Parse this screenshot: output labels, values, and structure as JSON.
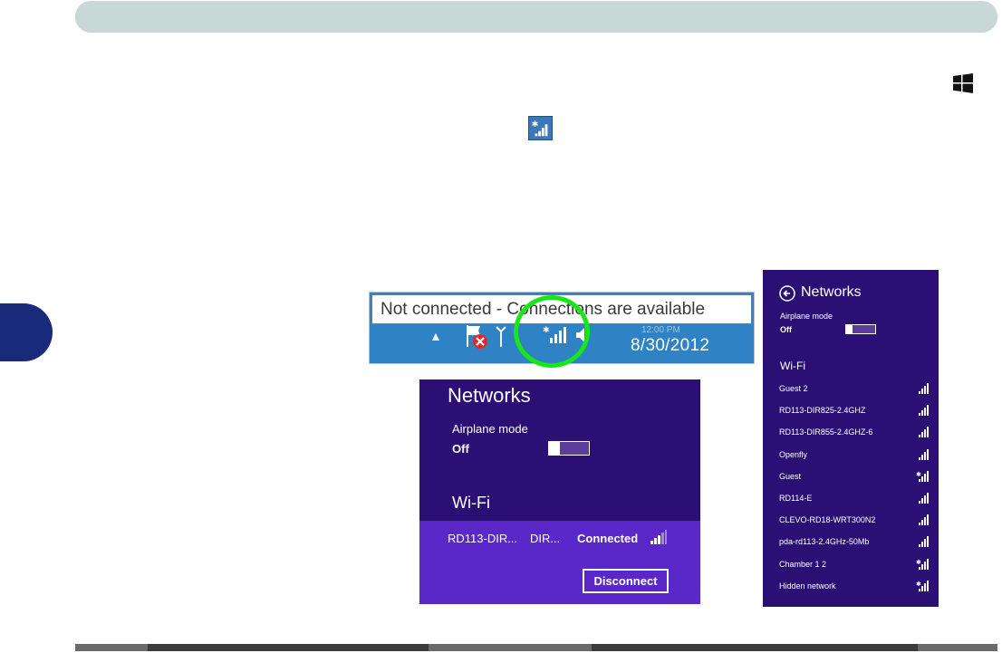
{
  "taskbar": {
    "tooltip": "Not connected - Connections are available",
    "date": "8/30/2012",
    "time_hidden": "12:00 PM"
  },
  "network_panel": {
    "title": "Networks",
    "airplane_mode_label": "Airplane mode",
    "airplane_mode_state": "Off",
    "airplane_mode_value": 0,
    "wifi_label": "Wi-Fi",
    "connected_network": {
      "name": "RD113-DIR...",
      "secondary": "DIR...",
      "status": "Connected"
    },
    "disconnect_label": "Disconnect"
  },
  "networks_list": {
    "title": "Networks",
    "airplane_mode_label": "Airplane mode",
    "airplane_mode_state": "Off",
    "wifi_label": "Wi-Fi",
    "items": [
      {
        "name": "Guest 2",
        "secured": false
      },
      {
        "name": "RD113-DIR825-2.4GHZ",
        "secured": false
      },
      {
        "name": "RD113-DIR855-2.4GHZ-6",
        "secured": false
      },
      {
        "name": "Openfly",
        "secured": false
      },
      {
        "name": "Guest",
        "secured": true
      },
      {
        "name": "RD114-E",
        "secured": false
      },
      {
        "name": "CLEVO-RD18-WRT300N2",
        "secured": false
      },
      {
        "name": "pda-rd113-2.4GHz-50Mb",
        "secured": false
      },
      {
        "name": "Chamber 1 2",
        "secured": true
      },
      {
        "name": "Hidden network",
        "secured": true
      }
    ]
  },
  "colors": {
    "header_bar": "#c7d8d6",
    "side_tab": "#1a2a7a",
    "panel_bg": "#2b0f74",
    "connected_row": "#5a28c8",
    "taskbar": "#2f82c4",
    "highlight_circle": "#17e617"
  },
  "icons": {
    "windows_logo": "windows-logo-icon",
    "inline_network": "wifi-network-icon",
    "tray_flag": "action-center-flag-icon",
    "tray_network": "network-signal-icon",
    "tray_volume": "speaker-icon",
    "back": "back-arrow-icon"
  }
}
